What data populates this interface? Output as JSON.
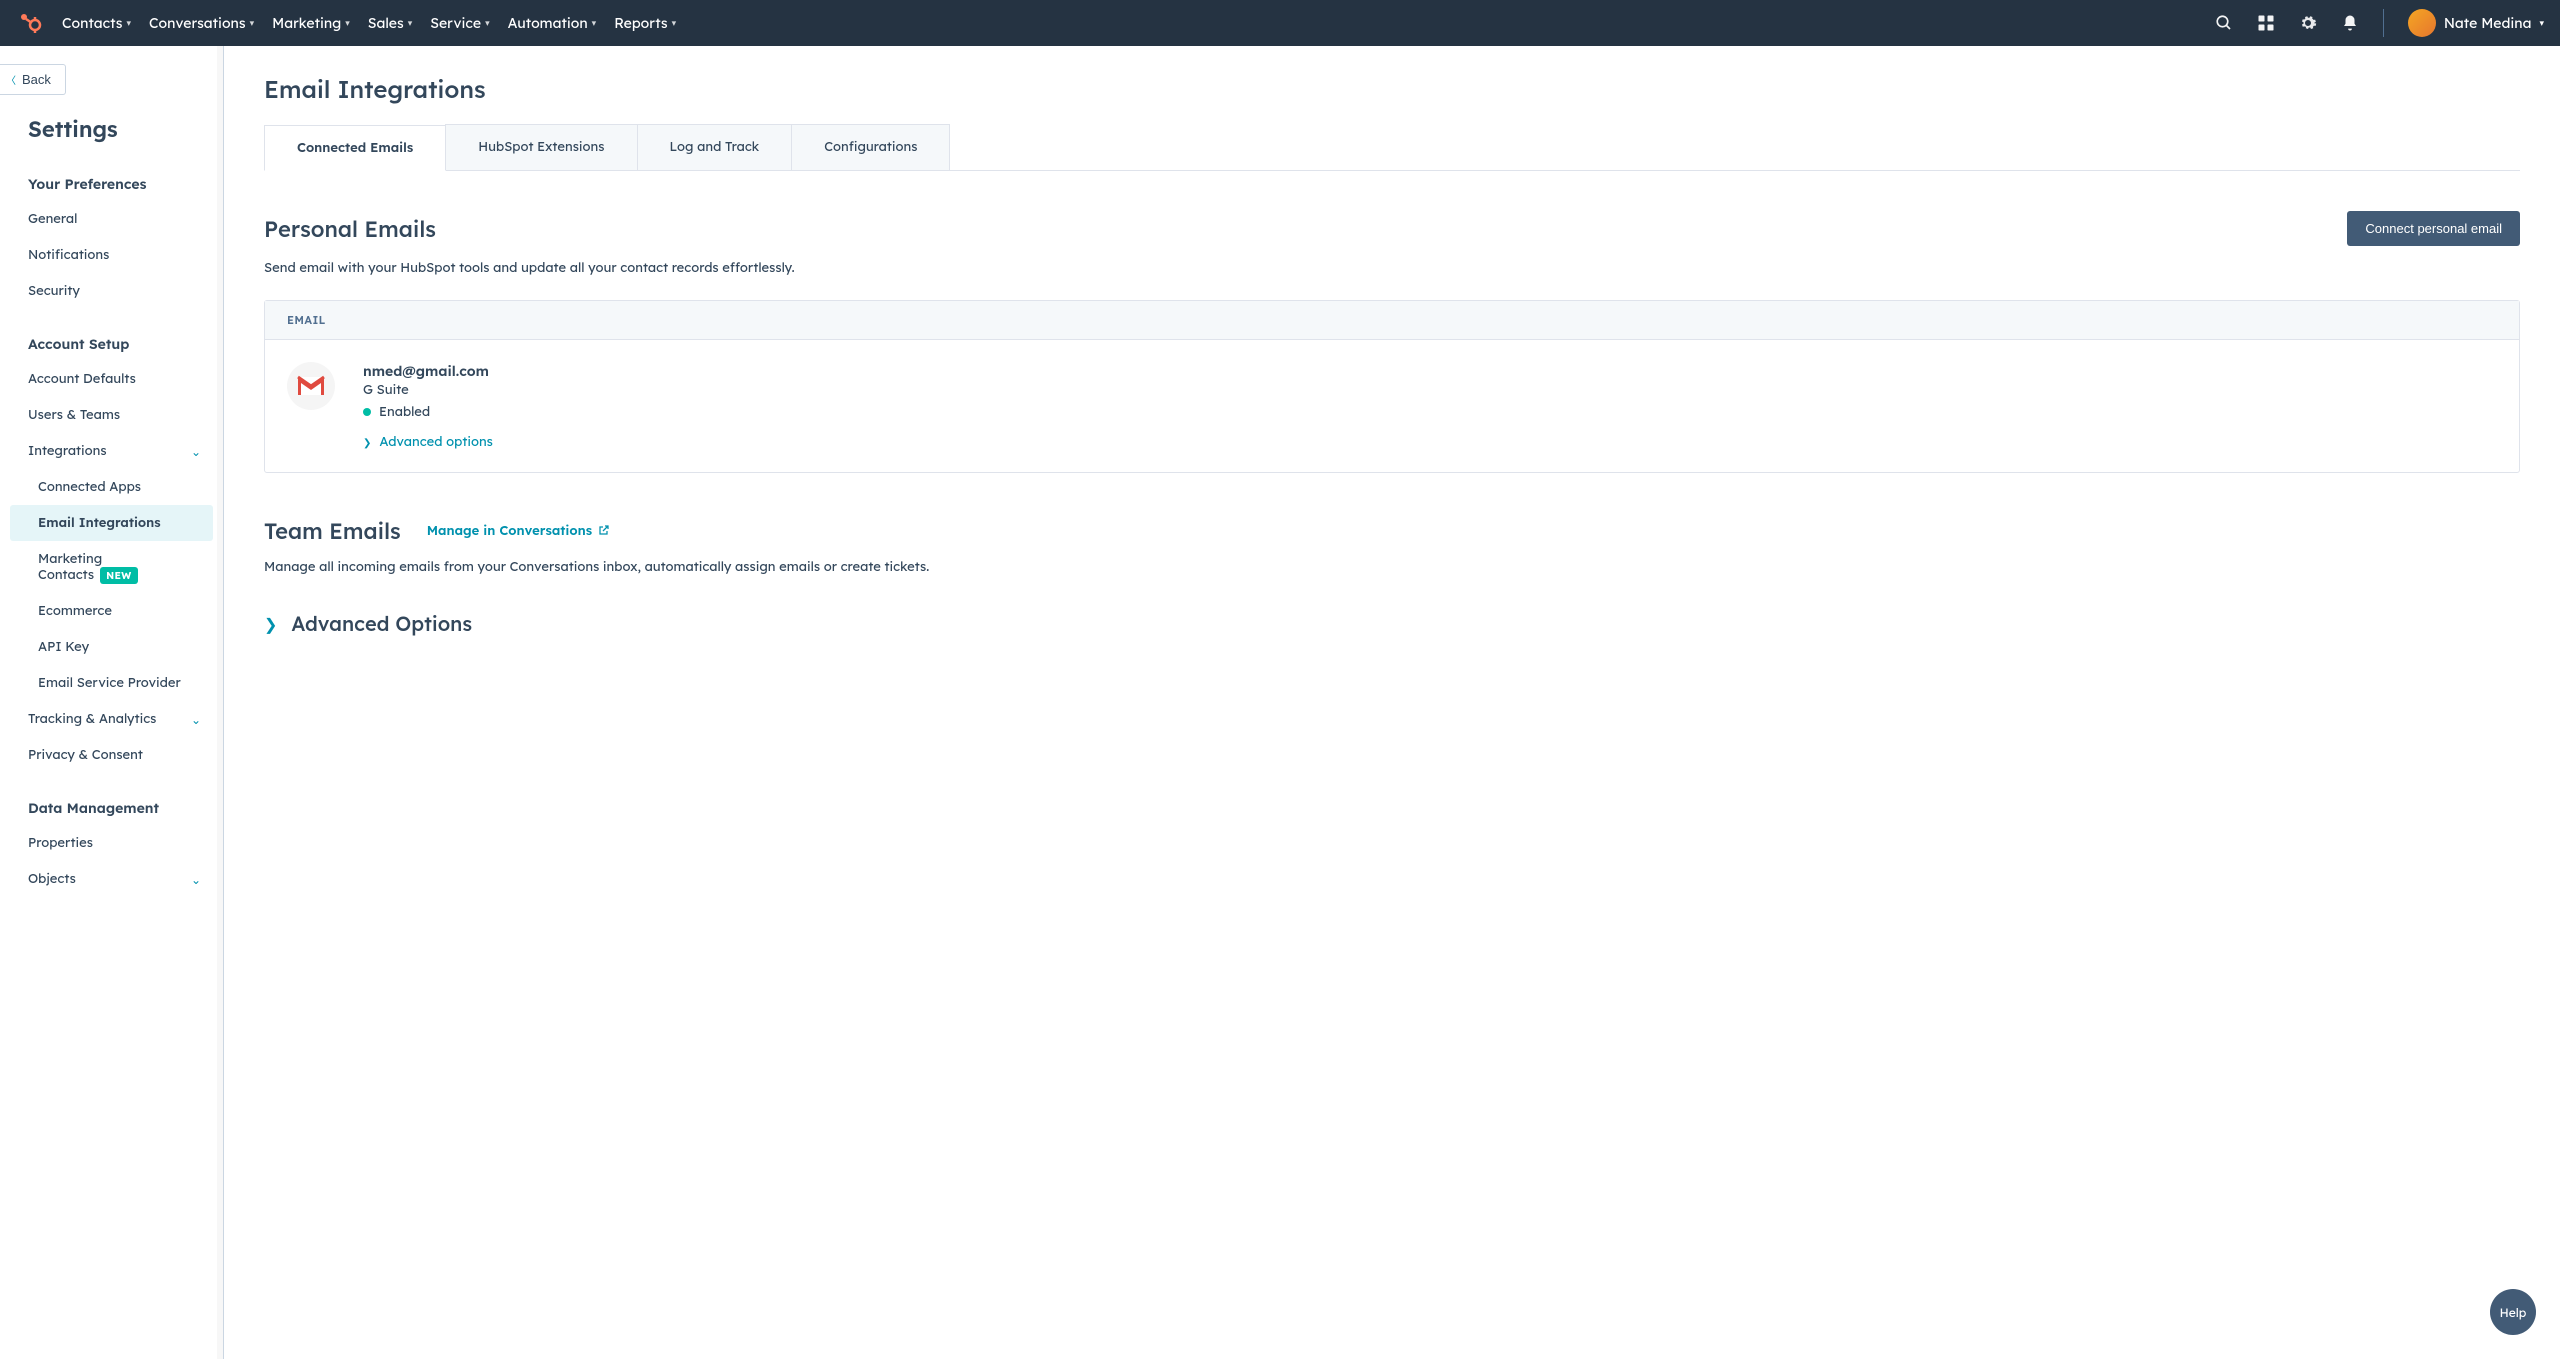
{
  "nav": {
    "items": [
      "Contacts",
      "Conversations",
      "Marketing",
      "Sales",
      "Service",
      "Automation",
      "Reports"
    ],
    "user_name": "Nate Medina"
  },
  "sidebar": {
    "back_label": "Back",
    "title": "Settings",
    "groups": {
      "prefs": {
        "title": "Your Preferences",
        "items": [
          "General",
          "Notifications",
          "Security"
        ]
      },
      "account": {
        "title": "Account Setup",
        "items": {
          "defaults": "Account Defaults",
          "users": "Users & Teams",
          "integrations": "Integrations",
          "sub": {
            "apps": "Connected Apps",
            "email_int": "Email Integrations",
            "marketing_contacts": "Marketing Contacts",
            "mc_badge": "NEW",
            "ecom": "Ecommerce",
            "api": "API Key",
            "esp": "Email Service Provider"
          },
          "tracking": "Tracking & Analytics",
          "privacy": "Privacy & Consent"
        }
      },
      "data": {
        "title": "Data Management",
        "items": {
          "properties": "Properties",
          "objects": "Objects"
        }
      }
    }
  },
  "page": {
    "title": "Email Integrations",
    "tabs": [
      "Connected Emails",
      "HubSpot Extensions",
      "Log and Track",
      "Configurations"
    ],
    "personal": {
      "heading": "Personal Emails",
      "button": "Connect personal email",
      "sub": "Send email with your HubSpot tools and update all your contact records effortlessly.",
      "col_email": "EMAIL",
      "account": {
        "email": "nmed@gmail.com",
        "provider": "G Suite",
        "status": "Enabled",
        "adv": "Advanced options"
      }
    },
    "team": {
      "heading": "Team Emails",
      "manage": "Manage in Conversations",
      "sub": "Manage all incoming emails from your Conversations inbox, automatically assign emails or create tickets."
    },
    "adv_heading": "Advanced Options",
    "help": "Help"
  }
}
